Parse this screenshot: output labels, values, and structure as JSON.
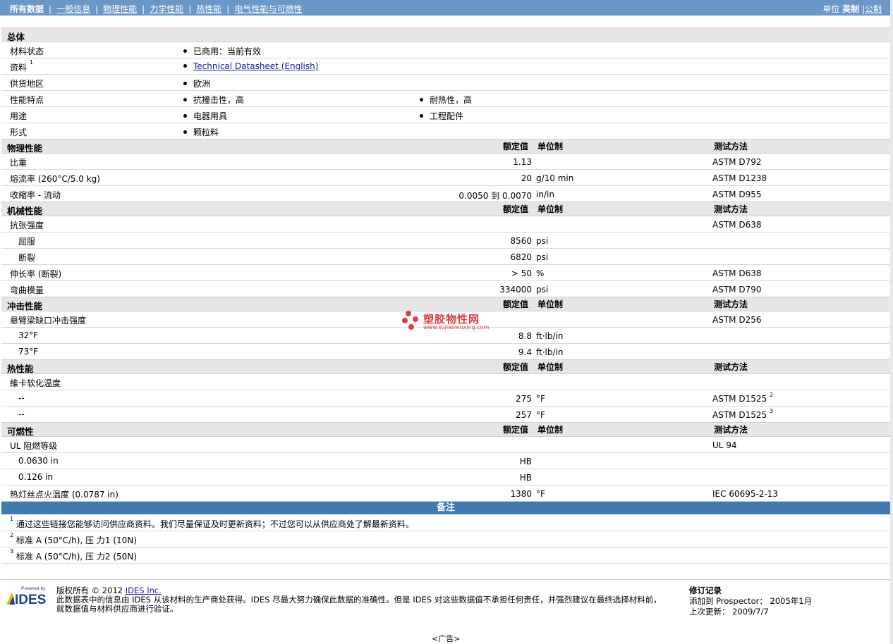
{
  "topbar": {
    "nav": [
      {
        "label": "所有数据",
        "active": true
      },
      {
        "label": "一般信息"
      },
      {
        "label": "物理性能"
      },
      {
        "label": "力学性能"
      },
      {
        "label": "热性能"
      },
      {
        "label": "电气性能与可燃性"
      }
    ],
    "units_label": "单位",
    "units_current": "英制",
    "units_other": "公制"
  },
  "general": {
    "title": "总体",
    "rows": {
      "status": {
        "label": "材料状态",
        "v1": "已商用：当前有效"
      },
      "docs": {
        "label": "资料",
        "sup": "1",
        "v1": "Technical Datasheet (English)"
      },
      "region": {
        "label": "供货地区",
        "v1": "欧洲"
      },
      "features": {
        "label": "性能特点",
        "v1": "抗撞击性，高",
        "v2": "耐热性，高"
      },
      "uses": {
        "label": "用途",
        "v1": "电器用具",
        "v2": "工程配件"
      },
      "form": {
        "label": "形式",
        "v1": "颗粒料"
      }
    }
  },
  "headers": {
    "nominal": "额定值",
    "unit": "单位制",
    "method": "测试方法"
  },
  "physical": {
    "title": "物理性能",
    "rows": [
      {
        "label": "比重",
        "value": "1.13",
        "unit": "",
        "method": "ASTM D792"
      },
      {
        "label": "熔流率 (260°C/5.0 kg)",
        "value": "20",
        "unit": "g/10 min",
        "method": "ASTM D1238"
      },
      {
        "label": "收缩率 - 流动",
        "value": "0.0050 到  0.0070",
        "unit": "in/in",
        "method": "ASTM D955"
      }
    ]
  },
  "mechanical": {
    "title": "机械性能",
    "rows": [
      {
        "label": "抗张强度",
        "value": "",
        "unit": "",
        "method": "ASTM D638"
      },
      {
        "label": "屈服",
        "value": "8560",
        "unit": "psi",
        "method": "",
        "indent": true
      },
      {
        "label": "断裂",
        "value": "6820",
        "unit": "psi",
        "method": "",
        "indent": true
      },
      {
        "label": "伸长率 (断裂)",
        "value": "> 50",
        "unit": "%",
        "method": "ASTM D638"
      },
      {
        "label": "弯曲模量",
        "value": "334000",
        "unit": "psi",
        "method": "ASTM D790"
      }
    ]
  },
  "impact": {
    "title": "冲击性能",
    "rows": [
      {
        "label": "悬臂梁缺口冲击强度",
        "value": "",
        "unit": "",
        "method": "ASTM D256"
      },
      {
        "label": "32°F",
        "value": "8.8",
        "unit": "ft·lb/in",
        "method": "",
        "indent": true
      },
      {
        "label": "73°F",
        "value": "9.4",
        "unit": "ft·lb/in",
        "method": "",
        "indent": true
      }
    ]
  },
  "thermal": {
    "title": "热性能",
    "rows": [
      {
        "label": "維卡软化温度",
        "value": "",
        "unit": "",
        "method": ""
      },
      {
        "label": "--",
        "value": "275",
        "unit": "°F",
        "method": "ASTM D1525",
        "sup": "2",
        "indent": true
      },
      {
        "label": "--",
        "value": "257",
        "unit": "°F",
        "method": "ASTM D1525",
        "sup": "3",
        "indent": true
      }
    ]
  },
  "flammability": {
    "title": "可燃性",
    "rows": [
      {
        "label": "UL 阻燃等级",
        "value": "",
        "unit": "",
        "method": "UL 94"
      },
      {
        "label": "0.0630 in",
        "value": "HB",
        "unit": "",
        "method": "",
        "indent": true
      },
      {
        "label": "0.126 in",
        "value": "HB",
        "unit": "",
        "method": "",
        "indent": true
      },
      {
        "label": "热灯丝点火温度 (0.0787 in)",
        "value": "1380",
        "unit": "°F",
        "method": "IEC 60695-2-13"
      }
    ]
  },
  "notes": {
    "title": "备注",
    "items": [
      {
        "num": "1",
        "text": "通过这些链接您能够访问供应商资料。我们尽量保证及时更新资料；不过您可以从供应商处了解最新资料。"
      },
      {
        "num": "2",
        "text": "标准  A (50°C/h), 压  力1 (10N)"
      },
      {
        "num": "3",
        "text": "标准  A (50°C/h), 压  力2 (50N)"
      }
    ]
  },
  "footer": {
    "logo_small": "Powered by",
    "logo_text": "IDES",
    "copyright": "版权所有  © 2012 ",
    "copyright_link": "IDES Inc.",
    "line2": "此数据表中的信息由  IDES 从该材料的生产商处获得。IDES 尽最大努力确保此数据的准确性。但是  IDES 对这些数据值不承担任何责任，并强烈建议在最终选择材料前，",
    "line3": "就数据值与材料供应商进行验证。",
    "rev_title": "修订记录",
    "rev_added": "添加到  Prospector：  2005年1月",
    "rev_updated": "上次更新：    2009/7/7",
    "ad": "<广告>"
  },
  "watermark": {
    "name": "塑胶物性网",
    "url": "www.sujiaowuxing.com"
  }
}
